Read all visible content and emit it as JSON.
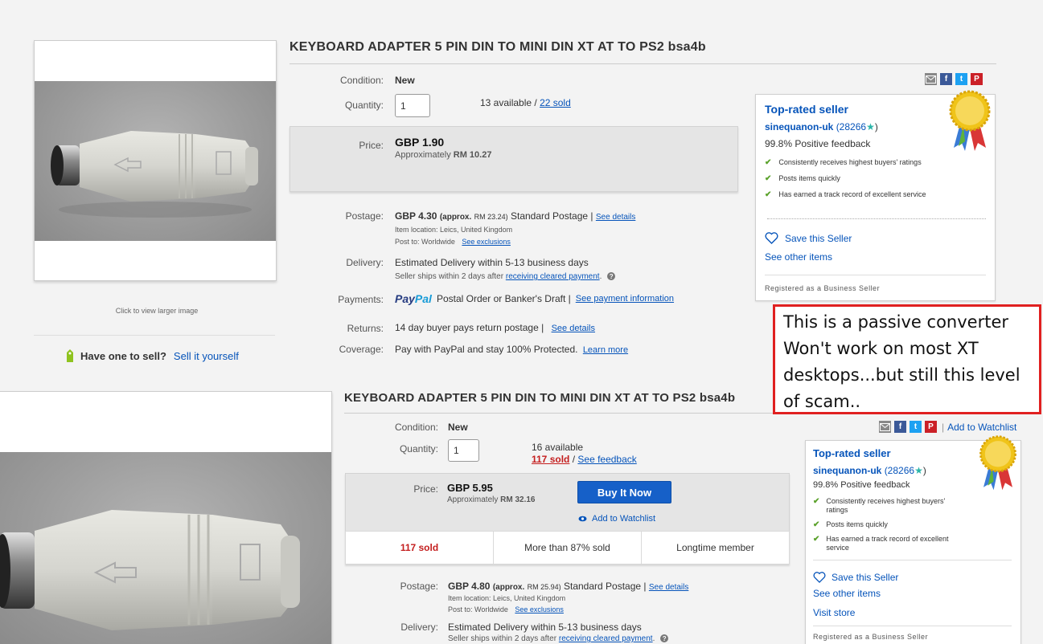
{
  "colors": {
    "link": "#0654ba",
    "buy_button": "#1660c8",
    "sold_red": "#c41e1e",
    "annotation_border": "#e02020",
    "check": "#5ba22c"
  },
  "listing1": {
    "image_caption": "Click to view larger image",
    "sell": {
      "prefix": "Have one to sell?",
      "link": "Sell it yourself"
    },
    "title": "KEYBOARD ADAPTER 5 PIN DIN TO MINI DIN XT AT TO PS2 bsa4b",
    "condition_label": "Condition:",
    "condition_value": "New",
    "quantity_label": "Quantity:",
    "quantity_value": "1",
    "available": "13 available / ",
    "sold_link": "22 sold",
    "price_label": "Price:",
    "price": "GBP 1.90",
    "approx_prefix": "Approximately ",
    "approx_value": "RM 10.27",
    "postage_label": "Postage:",
    "postage_value": "GBP 4.30",
    "postage_approx_prefix": "(approx.",
    "postage_approx_value": "RM 23.24)",
    "postage_type": "Standard Postage |",
    "see_details": "See details",
    "item_location": "Item location:  Leics, United Kingdom",
    "post_to": "Post to:  Worldwide",
    "see_exclusions": "See exclusions",
    "delivery_label": "Delivery:",
    "delivery_value": "Estimated Delivery within 5-13 business days",
    "ships_prefix": "Seller ships within 2 days after",
    "ships_link": "receiving cleared payment",
    "payments_label": "Payments:",
    "paypal_a": "Pay",
    "paypal_b": "Pal",
    "payments_value": "Postal Order or Banker's Draft  |",
    "payment_info": "See payment information",
    "returns_label": "Returns:",
    "returns_value": "14 day buyer pays return postage |",
    "returns_details": "See details",
    "coverage_label": "Coverage:",
    "coverage_value": "Pay with PayPal and stay 100% Protected.",
    "learn_more": "Learn more",
    "seller": {
      "badge": "Top-rated seller",
      "name": "sinequanon-uk",
      "feedback_open": "(28266",
      "feedback_close": ")",
      "positive": "99.8% Positive feedback",
      "perks": [
        "Consistently receives highest buyers' ratings",
        "Posts items quickly",
        "Has earned a track record of excellent service"
      ],
      "save": "Save this Seller",
      "other": "See other items",
      "registered": "Registered as a Business Seller"
    }
  },
  "annotation": "This is a passive converter Won't work on most XT desktops...but still this level of scam..",
  "listing2": {
    "title": "KEYBOARD ADAPTER 5 PIN DIN TO MINI DIN XT AT TO PS2 bsa4b",
    "condition_label": "Condition:",
    "condition_value": "New",
    "quantity_label": "Quantity:",
    "quantity_value": "1",
    "available": "16 available",
    "sold_link": "117 sold",
    "feedback_sep": " / ",
    "feedback_link": "See feedback",
    "watchlist_top": "Add to Watchlist",
    "price_label": "Price:",
    "price": "GBP 5.95",
    "approx_prefix": "Approximately ",
    "approx_value": "RM 32.16",
    "buy_now": "Buy It Now",
    "add_watchlist": "Add to Watchlist",
    "stats": [
      "117 sold",
      "More than 87% sold",
      "Longtime member"
    ],
    "postage_label": "Postage:",
    "postage_value": "GBP 4.80",
    "postage_approx_prefix": "(approx.",
    "postage_approx_value": "RM 25.94)",
    "postage_type": "Standard Postage |",
    "see_details": "See details",
    "item_location": "Item location:  Leics, United Kingdom",
    "post_to": "Post to:  Worldwide",
    "see_exclusions": "See exclusions",
    "delivery_label": "Delivery:",
    "delivery_value": "Estimated Delivery within 5-13 business days",
    "ships_prefix": "Seller ships within 2 days after",
    "ships_link": "receiving cleared payment",
    "seller": {
      "badge": "Top-rated seller",
      "name": "sinequanon-uk",
      "feedback_open": "(28266",
      "feedback_close": ")",
      "positive": "99.8% Positive feedback",
      "perks": [
        "Consistently receives highest buyers' ratings",
        "Posts items quickly",
        "Has earned a track record of excellent service"
      ],
      "save": "Save this Seller",
      "other": "See other items",
      "visit": "Visit store",
      "registered": "Registered as a Business Seller"
    }
  },
  "icons": {
    "email": "email-icon",
    "facebook": "facebook-icon",
    "twitter": "twitter-icon",
    "pinterest": "pinterest-icon",
    "heart": "heart-icon",
    "eye": "eye-icon",
    "medal": "medal-icon",
    "tag": "tag-icon",
    "check": "check-icon"
  }
}
